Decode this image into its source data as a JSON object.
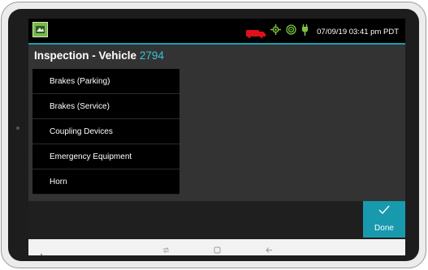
{
  "status_bar": {
    "time": "07/09/19 03:41 pm PDT",
    "icons": [
      "app-logo-icon",
      "truck-icon",
      "gps-icon",
      "signal-icon",
      "power-plug-icon"
    ],
    "colors": {
      "truck": "#e0101b",
      "gps": "#7cc242",
      "plug": "#7cc242",
      "accent": "#1aa0b0"
    }
  },
  "header": {
    "title": "Inspection - Vehicle",
    "vehicle_number": "2794"
  },
  "inspection_list": {
    "items": [
      {
        "label": "Brakes (Parking)"
      },
      {
        "label": "Brakes (Service)"
      },
      {
        "label": "Coupling Devices"
      },
      {
        "label": "Emergency Equipment"
      },
      {
        "label": "Horn"
      }
    ]
  },
  "actions": {
    "done_label": "Done",
    "done_color": "#1899ad"
  },
  "system_nav": {
    "icons": [
      "nav-dot-icon",
      "recent-apps-icon",
      "home-icon",
      "back-icon"
    ]
  }
}
